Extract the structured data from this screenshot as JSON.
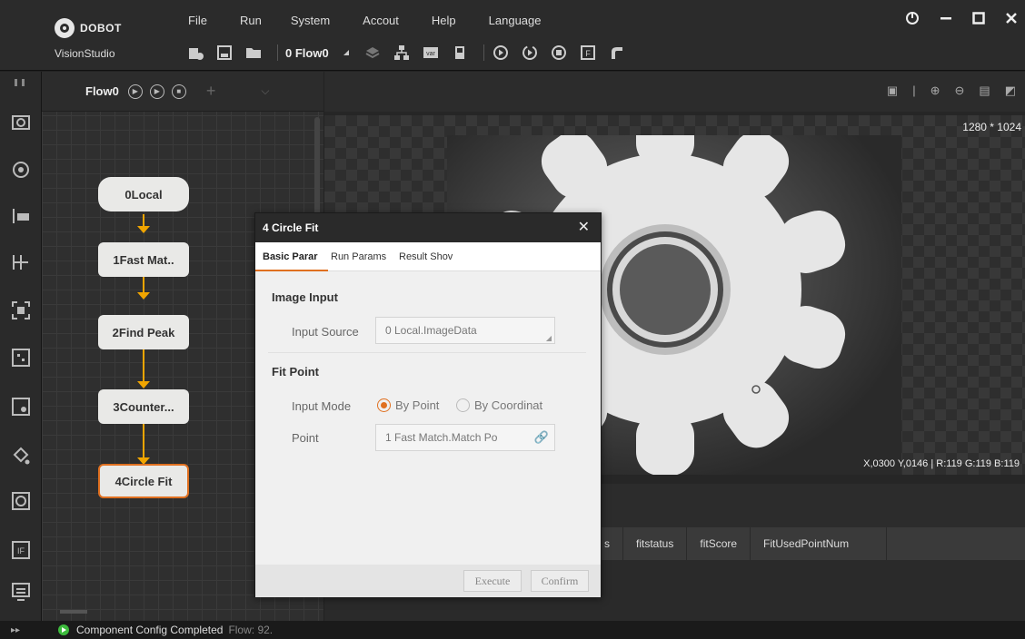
{
  "app": {
    "brand": "DOBOT",
    "product": "VisionStudio"
  },
  "menu": [
    "File",
    "Run",
    "System",
    "Accout",
    "Help",
    "Language"
  ],
  "toolbar": {
    "flow_selector": "0 Flow0"
  },
  "flow_panel": {
    "title": "Flow0",
    "nodes": [
      {
        "label": "0Local"
      },
      {
        "label": "1Fast Mat.."
      },
      {
        "label": "2Find Peak"
      },
      {
        "label": "3Counter..."
      },
      {
        "label": "4Circle Fit"
      }
    ],
    "active_node": "4Circle Fit",
    "connector_color": "#f0a500",
    "active_border_color": "#e07020"
  },
  "image_view": {
    "resolution": "1280 * 1024",
    "pixel_info": "X,0300 Y,0146 | R:119 G:119 B:119"
  },
  "results": {
    "columns": [
      "s",
      "fitstatus",
      "fitScore",
      "FitUsedPointNum"
    ]
  },
  "status": {
    "message": "Component Config Completed",
    "flow": "Flow: 92."
  },
  "dialog": {
    "title": "4 Circle Fit",
    "close": "✕",
    "tabs": [
      "Basic Parar",
      "Run Params",
      "Result Shov"
    ],
    "image_input": {
      "section": "Image Input",
      "input_source_label": "Input Source",
      "input_source_value": "0 Local.ImageData"
    },
    "fit_point": {
      "section": "Fit Point",
      "input_mode_label": "Input Mode",
      "option_by_point": "By Point",
      "option_by_coordinate": "By Coordinat",
      "selected": "By Point",
      "point_label": "Point",
      "point_value": "1 Fast Match.Match Po"
    },
    "buttons": {
      "execute": "Execute",
      "confirm": "Confirm"
    },
    "accent_color": "#e07020"
  }
}
